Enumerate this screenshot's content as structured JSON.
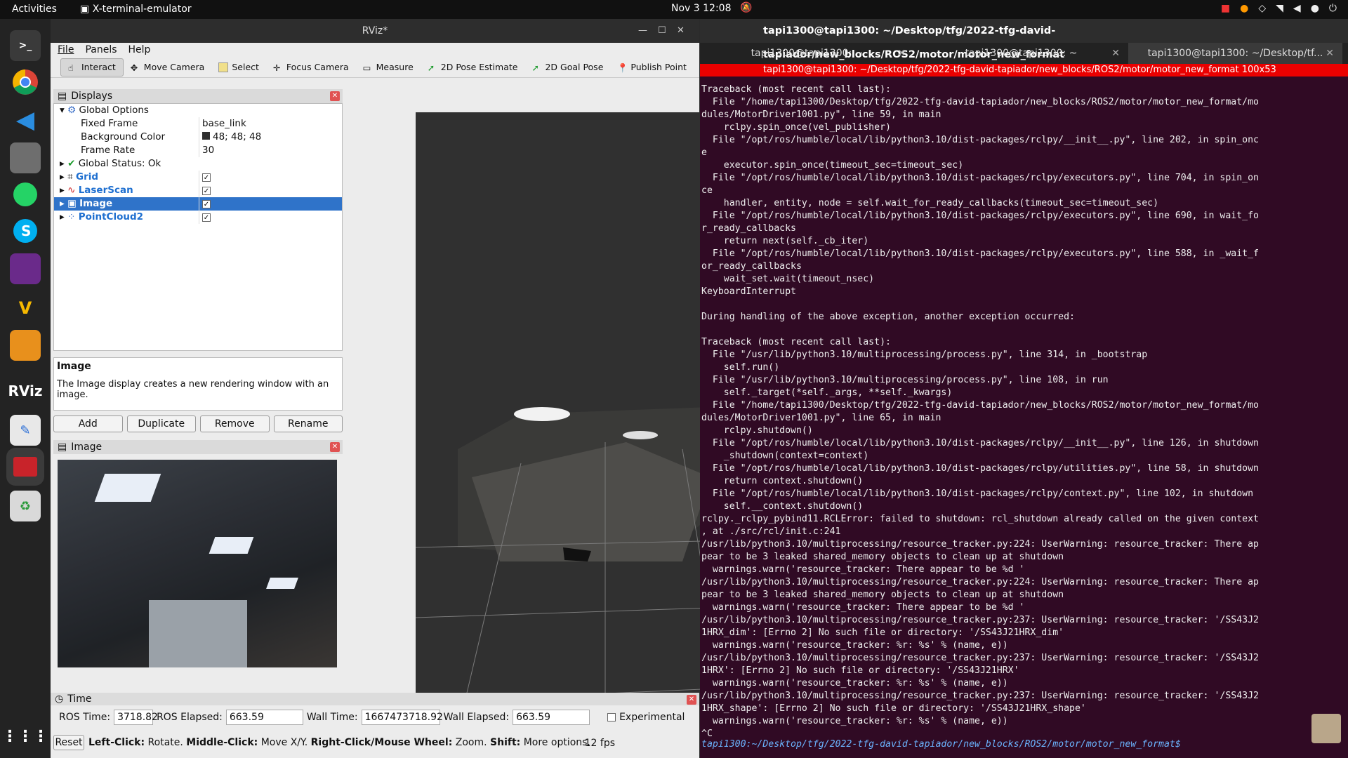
{
  "topbar": {
    "activities": "Activities",
    "app": "X-terminal-emulator",
    "clock": "Nov 3  12:08"
  },
  "rviz": {
    "title": "RViz*",
    "menu": [
      "File",
      "Panels",
      "Help"
    ],
    "tools": [
      "Interact",
      "Move Camera",
      "Select",
      "Focus Camera",
      "Measure",
      "2D Pose Estimate",
      "2D Goal Pose",
      "Publish Point"
    ],
    "displays_title": "Displays",
    "tree": [
      {
        "label": "Global Options",
        "value": ""
      },
      {
        "label": "Fixed Frame",
        "value": "base_link"
      },
      {
        "label": "Background Color",
        "value": "48; 48; 48"
      },
      {
        "label": "Frame Rate",
        "value": "30"
      },
      {
        "label": "Global Status: Ok",
        "value": ""
      },
      {
        "label": "Grid",
        "value": ""
      },
      {
        "label": "LaserScan",
        "value": ""
      },
      {
        "label": "Image",
        "value": ""
      },
      {
        "label": "PointCloud2",
        "value": ""
      }
    ],
    "desc_title": "Image",
    "desc_text": "The Image display creates a new rendering window with an image.",
    "buttons": [
      "Add",
      "Duplicate",
      "Remove",
      "Rename"
    ],
    "image_panel": "Image",
    "time": {
      "title": "Time",
      "ros_time_label": "ROS Time:",
      "ros_time": "3718.82",
      "ros_elapsed_label": "ROS Elapsed:",
      "ros_elapsed": "663.59",
      "wall_time_label": "Wall Time:",
      "wall_time": "1667473718.92",
      "wall_elapsed_label": "Wall Elapsed:",
      "wall_elapsed": "663.59",
      "experimental": "Experimental",
      "reset": "Reset",
      "hint_b1": "Left-Click:",
      "hint_t1": " Rotate. ",
      "hint_b2": "Middle-Click:",
      "hint_t2": " Move X/Y. ",
      "hint_b3": "Right-Click/Mouse Wheel:",
      "hint_t3": " Zoom. ",
      "hint_b4": "Shift:",
      "hint_t4": " More options.",
      "fps": "12 fps"
    }
  },
  "terminal": {
    "title": "tapi1300@tapi1300: ~/Desktop/tfg/2022-tfg-david-tapiador/new_blocks/ROS2/motor/motor_new_format",
    "tabs": [
      "tapi1300@tapi1300: ~",
      "tapi1300@tapi1300: ~",
      "tapi1300@tapi1300: ~/Desktop/tf..."
    ],
    "bar": "tapi1300@tapi1300: ~/Desktop/tfg/2022-tfg-david-tapiador/new_blocks/ROS2/motor/motor_new_format 100x53",
    "output": "Traceback (most recent call last):\n  File \"/home/tapi1300/Desktop/tfg/2022-tfg-david-tapiador/new_blocks/ROS2/motor/motor_new_format/mo\ndules/MotorDriver1001.py\", line 59, in main\n    rclpy.spin_once(vel_publisher)\n  File \"/opt/ros/humble/local/lib/python3.10/dist-packages/rclpy/__init__.py\", line 202, in spin_onc\ne\n    executor.spin_once(timeout_sec=timeout_sec)\n  File \"/opt/ros/humble/local/lib/python3.10/dist-packages/rclpy/executors.py\", line 704, in spin_on\nce\n    handler, entity, node = self.wait_for_ready_callbacks(timeout_sec=timeout_sec)\n  File \"/opt/ros/humble/local/lib/python3.10/dist-packages/rclpy/executors.py\", line 690, in wait_fo\nr_ready_callbacks\n    return next(self._cb_iter)\n  File \"/opt/ros/humble/local/lib/python3.10/dist-packages/rclpy/executors.py\", line 588, in _wait_f\nor_ready_callbacks\n    wait_set.wait(timeout_nsec)\nKeyboardInterrupt\n\nDuring handling of the above exception, another exception occurred:\n\nTraceback (most recent call last):\n  File \"/usr/lib/python3.10/multiprocessing/process.py\", line 314, in _bootstrap\n    self.run()\n  File \"/usr/lib/python3.10/multiprocessing/process.py\", line 108, in run\n    self._target(*self._args, **self._kwargs)\n  File \"/home/tapi1300/Desktop/tfg/2022-tfg-david-tapiador/new_blocks/ROS2/motor/motor_new_format/mo\ndules/MotorDriver1001.py\", line 65, in main\n    rclpy.shutdown()\n  File \"/opt/ros/humble/local/lib/python3.10/dist-packages/rclpy/__init__.py\", line 126, in shutdown\n    _shutdown(context=context)\n  File \"/opt/ros/humble/local/lib/python3.10/dist-packages/rclpy/utilities.py\", line 58, in shutdown\n    return context.shutdown()\n  File \"/opt/ros/humble/local/lib/python3.10/dist-packages/rclpy/context.py\", line 102, in shutdown\n    self.__context.shutdown()\nrclpy._rclpy_pybind11.RCLError: failed to shutdown: rcl_shutdown already called on the given context\n, at ./src/rcl/init.c:241\n/usr/lib/python3.10/multiprocessing/resource_tracker.py:224: UserWarning: resource_tracker: There ap\npear to be 3 leaked shared_memory objects to clean up at shutdown\n  warnings.warn('resource_tracker: There appear to be %d '\n/usr/lib/python3.10/multiprocessing/resource_tracker.py:224: UserWarning: resource_tracker: There ap\npear to be 3 leaked shared_memory objects to clean up at shutdown\n  warnings.warn('resource_tracker: There appear to be %d '\n/usr/lib/python3.10/multiprocessing/resource_tracker.py:237: UserWarning: resource_tracker: '/SS43J2\n1HRX_dim': [Errno 2] No such file or directory: '/SS43J21HRX_dim'\n  warnings.warn('resource_tracker: %r: %s' % (name, e))\n/usr/lib/python3.10/multiprocessing/resource_tracker.py:237: UserWarning: resource_tracker: '/SS43J2\n1HRX': [Errno 2] No such file or directory: '/SS43J21HRX'\n  warnings.warn('resource_tracker: %r: %s' % (name, e))\n/usr/lib/python3.10/multiprocessing/resource_tracker.py:237: UserWarning: resource_tracker: '/SS43J2\n1HRX_shape': [Errno 2] No such file or directory: '/SS43J21HRX_shape'\n  warnings.warn('resource_tracker: %r: %s' % (name, e))\n^C",
    "prompt": "tapi1300:~/Desktop/tfg/2022-tfg-david-tapiador/new_blocks/ROS2/motor/motor_new_format$"
  },
  "colors": {
    "accent": "#2f73c9",
    "terminal_bg": "#300a24",
    "error_bar": "#ea0000"
  }
}
